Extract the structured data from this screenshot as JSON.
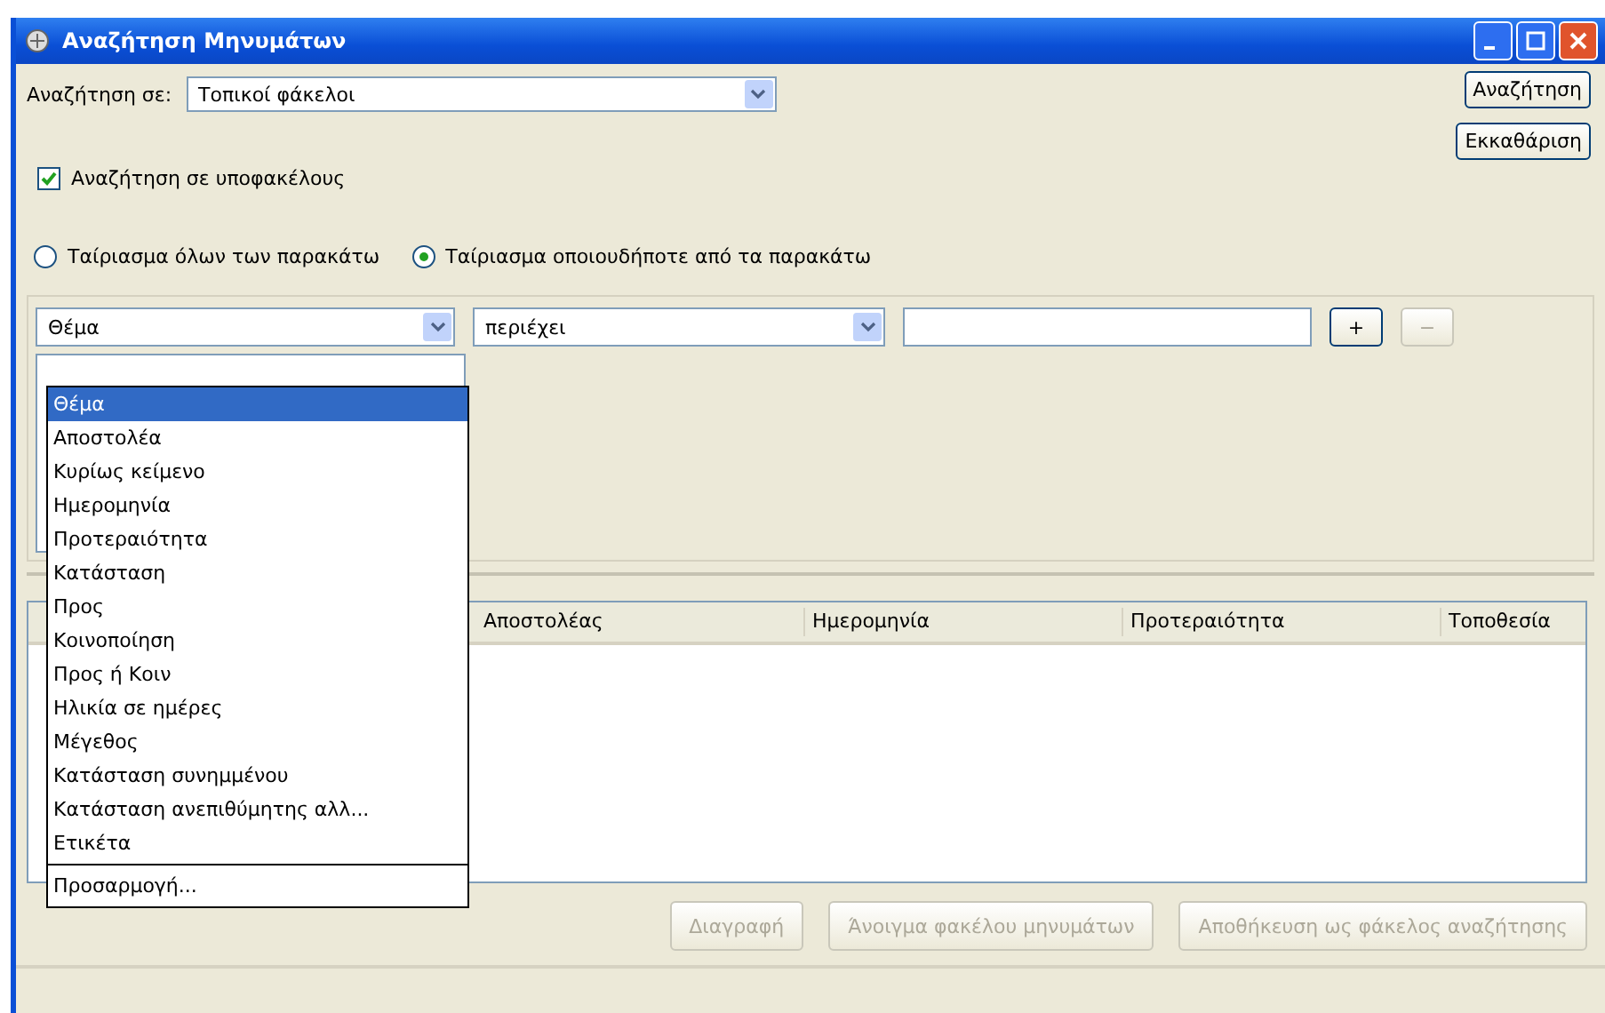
{
  "window": {
    "title": "Αναζήτηση Μηνυμάτων"
  },
  "search_in": {
    "label": "Αναζήτηση σε:",
    "value": "Τοπικοί φάκελοι"
  },
  "actions": [
    {
      "label": "Αναζήτηση"
    },
    {
      "label": "Εκκαθάριση"
    }
  ],
  "subfolders": {
    "label": "Αναζήτηση σε υποφακέλους",
    "checked": true
  },
  "match": [
    {
      "label": "Ταίριασμα όλων των παρακάτω",
      "selected": false
    },
    {
      "label": "Ταίριασμα οποιουδήποτε από τα παρακάτω",
      "selected": true
    }
  ],
  "criterion": {
    "field": "Θέμα",
    "operator": "περιέχει",
    "add": "+",
    "remove": "−",
    "remove_disabled": true
  },
  "dropdown": [
    {
      "label": "Θέμα",
      "kind": "option",
      "selected": true
    },
    {
      "label": "Αποστολέα",
      "kind": "option",
      "selected": false
    },
    {
      "label": "Κυρίως κείμενο",
      "kind": "option",
      "selected": false
    },
    {
      "label": "Ημερομηνία",
      "kind": "option",
      "selected": false
    },
    {
      "label": "Προτεραιότητα",
      "kind": "option",
      "selected": false
    },
    {
      "label": "Κατάσταση",
      "kind": "option",
      "selected": false
    },
    {
      "label": "Προς",
      "kind": "option",
      "selected": false
    },
    {
      "label": "Κοινοποίηση",
      "kind": "option",
      "selected": false
    },
    {
      "label": "Προς ή Κοιν",
      "kind": "option",
      "selected": false
    },
    {
      "label": "Ηλικία σε ημέρες",
      "kind": "option",
      "selected": false
    },
    {
      "label": "Μέγεθος",
      "kind": "option",
      "selected": false
    },
    {
      "label": "Κατάσταση συνημμένου",
      "kind": "option",
      "selected": false
    },
    {
      "label": "Κατάσταση ανεπιθύμητης αλλ...",
      "kind": "option",
      "selected": false
    },
    {
      "label": "Ετικέτα",
      "kind": "option",
      "selected": false
    },
    {
      "label": "Προσαρμογή...",
      "kind": "custom",
      "selected": false
    }
  ],
  "table": {
    "columns": [
      "Αποστολέας",
      "Ημερομηνία",
      "Προτεραιότητα",
      "Τοποθεσία"
    ]
  },
  "buttons": [
    {
      "label": "Διαγραφή",
      "disabled": true
    },
    {
      "label": "Άνοιγμα φακέλου μηνυμάτων",
      "disabled": true
    },
    {
      "label": "Αποθήκευση ως φάκελος αναζήτησης",
      "disabled": true
    }
  ]
}
